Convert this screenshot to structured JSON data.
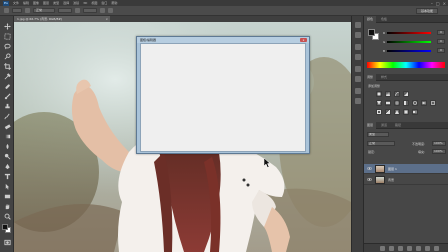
{
  "app": {
    "logo": "Ps",
    "menu": [
      "文件",
      "编辑",
      "图像",
      "图层",
      "类型",
      "选择",
      "滤镜",
      "3D",
      "视图",
      "窗口",
      "帮助"
    ],
    "window_controls": [
      "–",
      "□",
      "×"
    ]
  },
  "options_bar": {
    "mode_value": "正常",
    "workspace": "基本功能"
  },
  "document": {
    "tab_title": "1.jpg @ 66.7% (背景, RGB/8#)",
    "tab_close": "×"
  },
  "dialog": {
    "title": "图框/编辑器",
    "close": "x"
  },
  "color_panel": {
    "tabs": [
      "颜色",
      "色板"
    ],
    "sliders": [
      {
        "label": "R",
        "value": "0",
        "gradient": [
          "#000000",
          "#ff0000"
        ]
      },
      {
        "label": "G",
        "value": "0",
        "gradient": [
          "#000000",
          "#00ff00"
        ]
      },
      {
        "label": "B",
        "value": "0",
        "gradient": [
          "#000000",
          "#0000ff"
        ]
      }
    ],
    "foreground": "#111111",
    "background": "#ffffff"
  },
  "adjustments_panel": {
    "tabs": [
      "调整",
      "样式"
    ],
    "title": "添加调整"
  },
  "layers_panel": {
    "tabs": [
      "图层",
      "通道",
      "路径"
    ],
    "filter_value": "类型",
    "blend_mode": "正常",
    "opacity_label": "不透明度:",
    "opacity_value": "100%",
    "lock_label": "锁定:",
    "fill_label": "填充:",
    "fill_value": "100%",
    "layers": [
      {
        "name": "图层 1",
        "selected": true,
        "visible": true
      },
      {
        "name": "背景",
        "selected": false,
        "visible": true
      }
    ]
  }
}
